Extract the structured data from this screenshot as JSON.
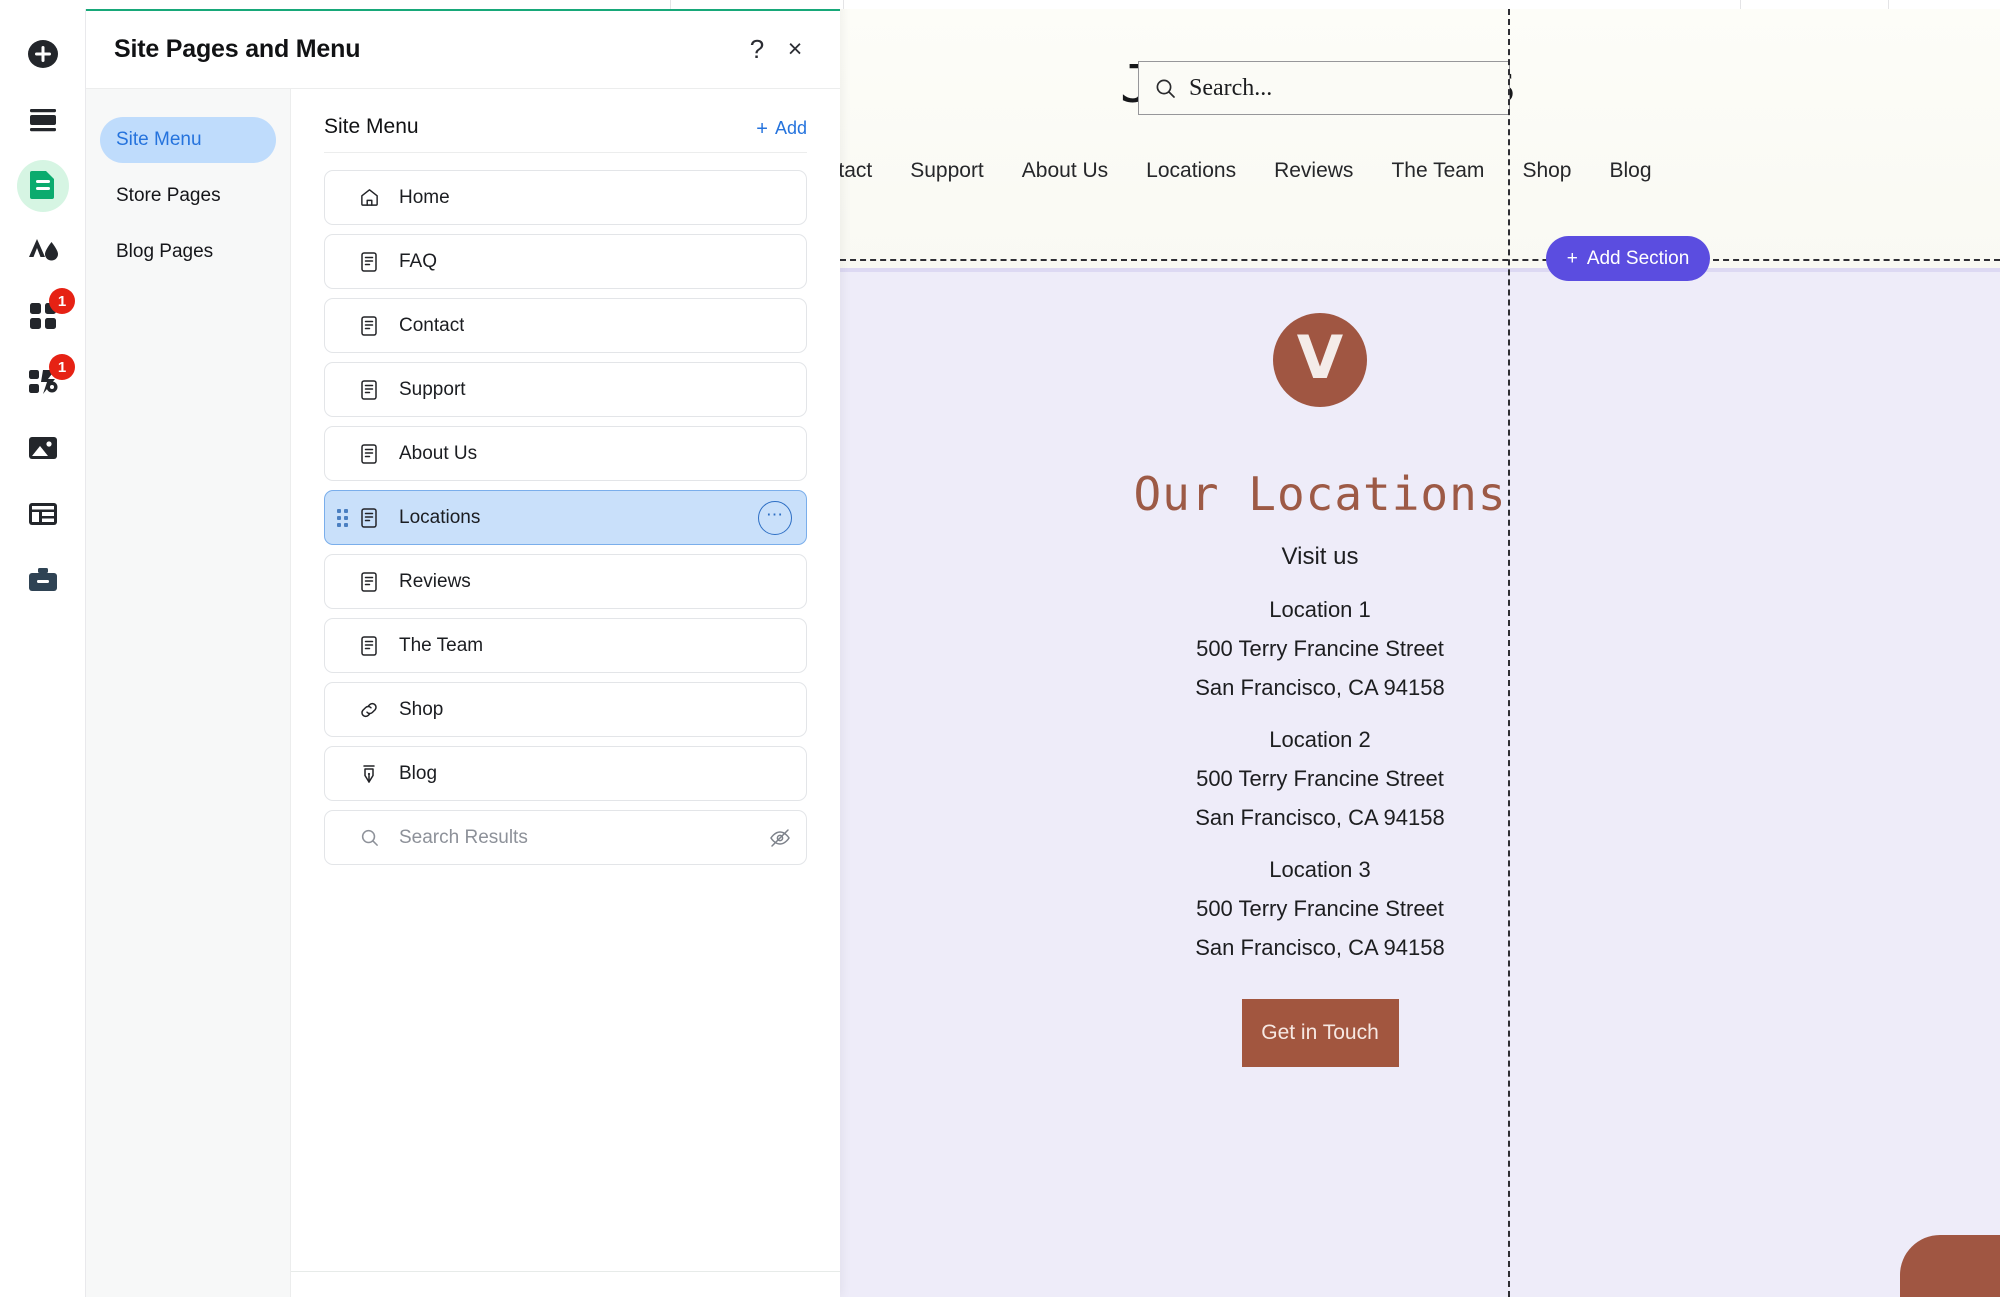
{
  "colors": {
    "panel_accent": "#17a879",
    "selected_row": "#c9e0fa",
    "link_blue": "#2573dd",
    "badge_red": "#e62214",
    "add_section_purple": "#5b4de0",
    "site_section_bg": "#eeecf9",
    "brand_brown": "#a05642",
    "heading_brown": "#9d5a46"
  },
  "rail": {
    "items": [
      {
        "name": "add-icon",
        "badge": ""
      },
      {
        "name": "sections-icon",
        "badge": ""
      },
      {
        "name": "pages-icon",
        "badge": "",
        "active": true
      },
      {
        "name": "design-theme-icon",
        "badge": ""
      },
      {
        "name": "apps-icon",
        "badge": "1"
      },
      {
        "name": "integrations-icon",
        "badge": "1"
      },
      {
        "name": "media-icon",
        "badge": ""
      },
      {
        "name": "content-manager-icon",
        "badge": ""
      },
      {
        "name": "business-tools-icon",
        "badge": ""
      }
    ]
  },
  "panel": {
    "title": "Site Pages and Menu",
    "help_label": "?",
    "close_label": "×",
    "subnav": [
      {
        "label": "Site Menu",
        "active": true
      },
      {
        "label": "Store Pages",
        "active": false
      },
      {
        "label": "Blog Pages",
        "active": false
      }
    ],
    "list": {
      "title": "Site Menu",
      "add_label": "Add",
      "add_plus": "+",
      "more_label": "⋯",
      "items": [
        {
          "label": "Home",
          "icon": "home-icon",
          "selected": false,
          "placeholder": false
        },
        {
          "label": "FAQ",
          "icon": "page-icon",
          "selected": false,
          "placeholder": false
        },
        {
          "label": "Contact",
          "icon": "page-icon",
          "selected": false,
          "placeholder": false
        },
        {
          "label": "Support",
          "icon": "page-icon",
          "selected": false,
          "placeholder": false
        },
        {
          "label": "About Us",
          "icon": "page-icon",
          "selected": false,
          "placeholder": false
        },
        {
          "label": "Locations",
          "icon": "page-icon",
          "selected": true,
          "placeholder": false
        },
        {
          "label": "Reviews",
          "icon": "page-icon",
          "selected": false,
          "placeholder": false
        },
        {
          "label": "The Team",
          "icon": "page-icon",
          "selected": false,
          "placeholder": false
        },
        {
          "label": "Shop",
          "icon": "link-icon",
          "selected": false,
          "placeholder": false
        },
        {
          "label": "Blog",
          "icon": "pen-nib-icon",
          "selected": false,
          "placeholder": false
        },
        {
          "label": "Search Results",
          "icon": "search-icon",
          "selected": false,
          "placeholder": true
        }
      ]
    }
  },
  "preview": {
    "site_title": "John's Shoes",
    "search_placeholder": "Search...",
    "nav": [
      "ontact",
      "Support",
      "About Us",
      "Locations",
      "Reviews",
      "The Team",
      "Shop",
      "Blog"
    ],
    "add_section_label": "Add Section",
    "add_section_plus": "+",
    "logo_letter": "V",
    "section_title": "Our Locations",
    "section_subtitle": "Visit us",
    "locations": [
      {
        "name": "Location 1",
        "street": "500 Terry Francine Street",
        "city": "San Francisco, CA 94158"
      },
      {
        "name": "Location 2",
        "street": "500 Terry Francine Street",
        "city": "San Francisco, CA 94158"
      },
      {
        "name": "Location 3",
        "street": "500 Terry Francine Street",
        "city": "San Francisco, CA 94158"
      }
    ],
    "cta_label": "Get in Touch"
  }
}
